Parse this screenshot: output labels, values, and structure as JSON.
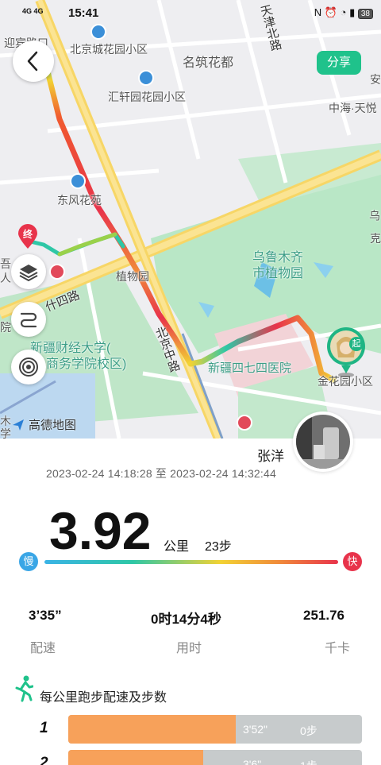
{
  "status_bar": {
    "time": "15:41",
    "network": "4G 4G",
    "battery": "38"
  },
  "map": {
    "labels": {
      "yingbin": "迎宾路口",
      "beijingcheng": "北京城花园小区",
      "mingzhu": "名筑花都",
      "tianjin_rd": "天津北路",
      "huixuan": "汇轩园花园小区",
      "zhonghai": "中海·天悦",
      "an": "安",
      "dongfeng": "东风花苑",
      "wulumuqi": "乌鲁木齐",
      "botanic": "市植物园",
      "zhiwu": "植物园",
      "shiba_rd": "什四路",
      "xinjiang_caijing": "新疆财经大学(",
      "shangwu": "商务学院校区)",
      "beijingzhong": "北京中路",
      "hospital": "新疆四七四医院",
      "jin_area": "金花园小区",
      "left_1": "吾",
      "left_2": "人",
      "left_3": "院",
      "left_4": "木",
      "left_5": "学",
      "wu": "乌",
      "ke": "克"
    },
    "end_marker": "终",
    "start_marker": "起",
    "gaode_logo": "高德地图",
    "share_label": "分享",
    "route_colors": {
      "slow": "#3ab3e6",
      "mid": "#f2d233",
      "fast": "#e8334b"
    }
  },
  "user": {
    "name": "张洋",
    "time_range": "2023-02-24 14:18:28 至 2023-02-24 14:32:44"
  },
  "summary": {
    "distance": "3.92",
    "distance_unit": "公里",
    "steps": "23步",
    "slow_label": "慢",
    "fast_label": "快"
  },
  "stats": {
    "pace_value": "3’35”",
    "pace_label": "配速",
    "duration_value": "0时14分4秒",
    "duration_label": "用时",
    "calories_value": "251.76",
    "calories_label": "千卡"
  },
  "per_km": {
    "title": "每公里跑步配速及步数",
    "rows": [
      {
        "km": "1",
        "pace": "3'52\"",
        "steps": "0步",
        "fraction": 0.57
      },
      {
        "km": "2",
        "pace": "3'6\"",
        "steps": "1步",
        "fraction": 0.46
      }
    ]
  },
  "colors": {
    "accent_green": "#1fc28b",
    "bar_orange": "#f7a15a",
    "bar_gray": "#c7cbcc"
  }
}
